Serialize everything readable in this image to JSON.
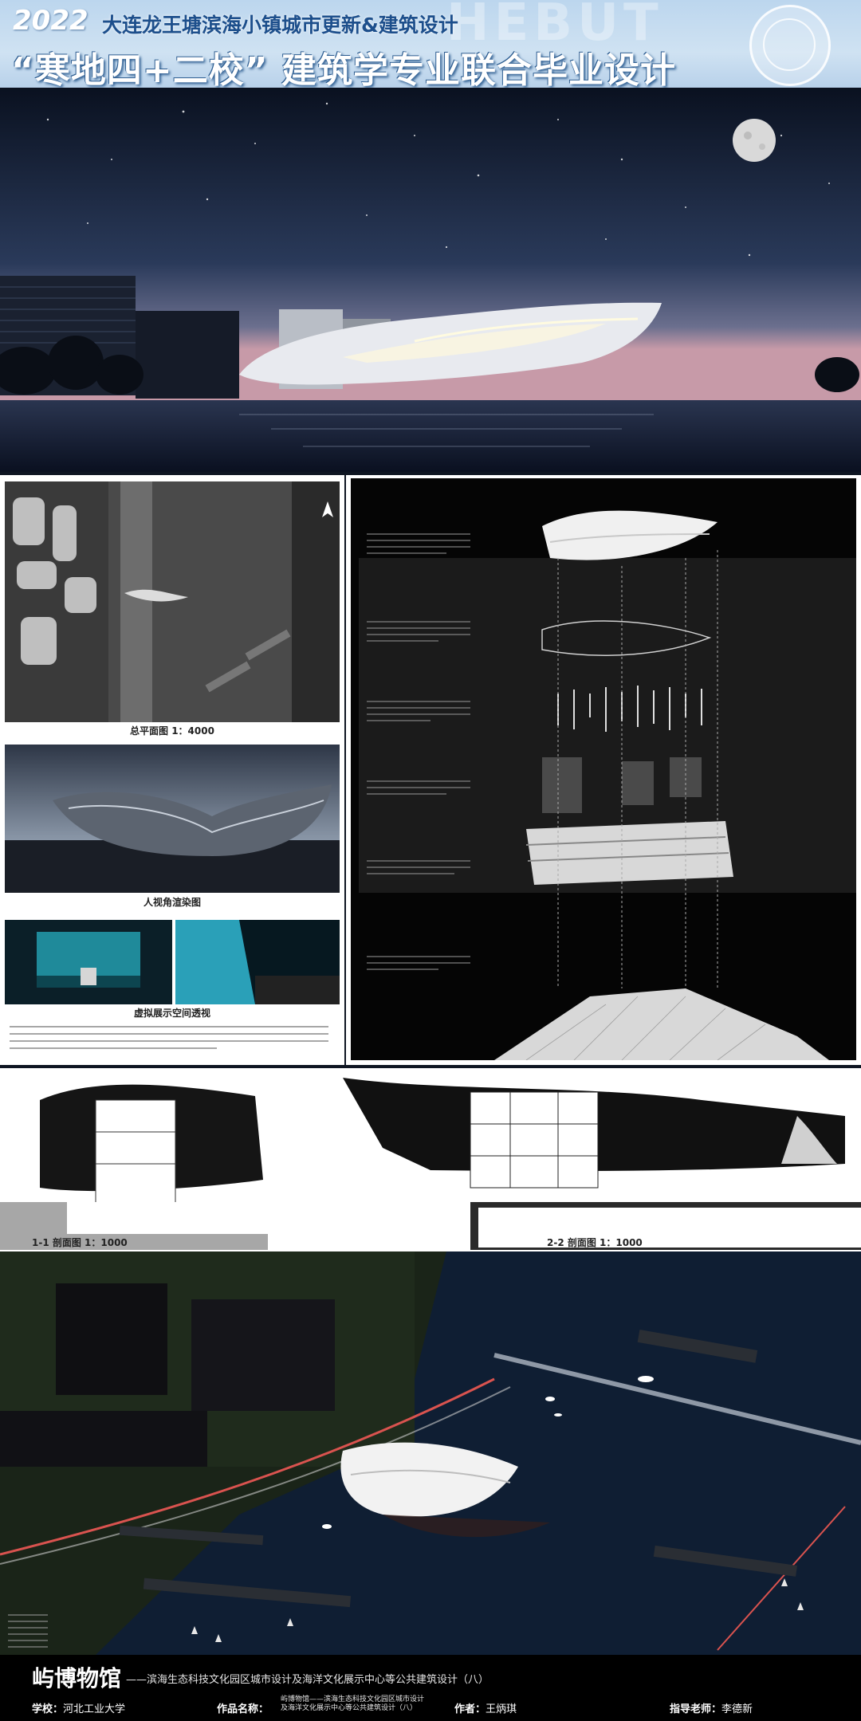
{
  "header": {
    "year": "2022",
    "subtitle": "大连龙王塘滨海小镇城市更新&建筑设计",
    "title": "“寒地四+二校” 建筑学专业联合毕业设计"
  },
  "panels": {
    "site_plan_caption": "总平面图 1：4000",
    "render_caption": "人视角渲染图",
    "virtual_caption": "虚拟展示空间透视",
    "section1_caption": "1-1 剖面图 1：1000",
    "section2_caption": "2-2 剖面图 1：1000"
  },
  "footer": {
    "museum_name": "屿博物馆",
    "project_desc": "——滨海生态科技文化园区城市设计及海洋文化展示中心等公共建筑设计（八）",
    "school_label": "学校：",
    "school": "河北工业大学",
    "work_label": "作品名称：",
    "work_line1": "屿博物馆——滨海生态科技文化园区城市设计",
    "work_line2": "及海洋文化展示中心等公共建筑设计（八）",
    "author_label": "作者：",
    "author": "王炳琪",
    "advisor_label": "指导老师：",
    "advisor": "李德新"
  },
  "colors": {
    "header_bg": "#c6dcf0",
    "title_blue": "#1d4f8c",
    "footer_bg": "#000000",
    "sky_top": "#0c1426",
    "sea": "#0e1a2e"
  }
}
